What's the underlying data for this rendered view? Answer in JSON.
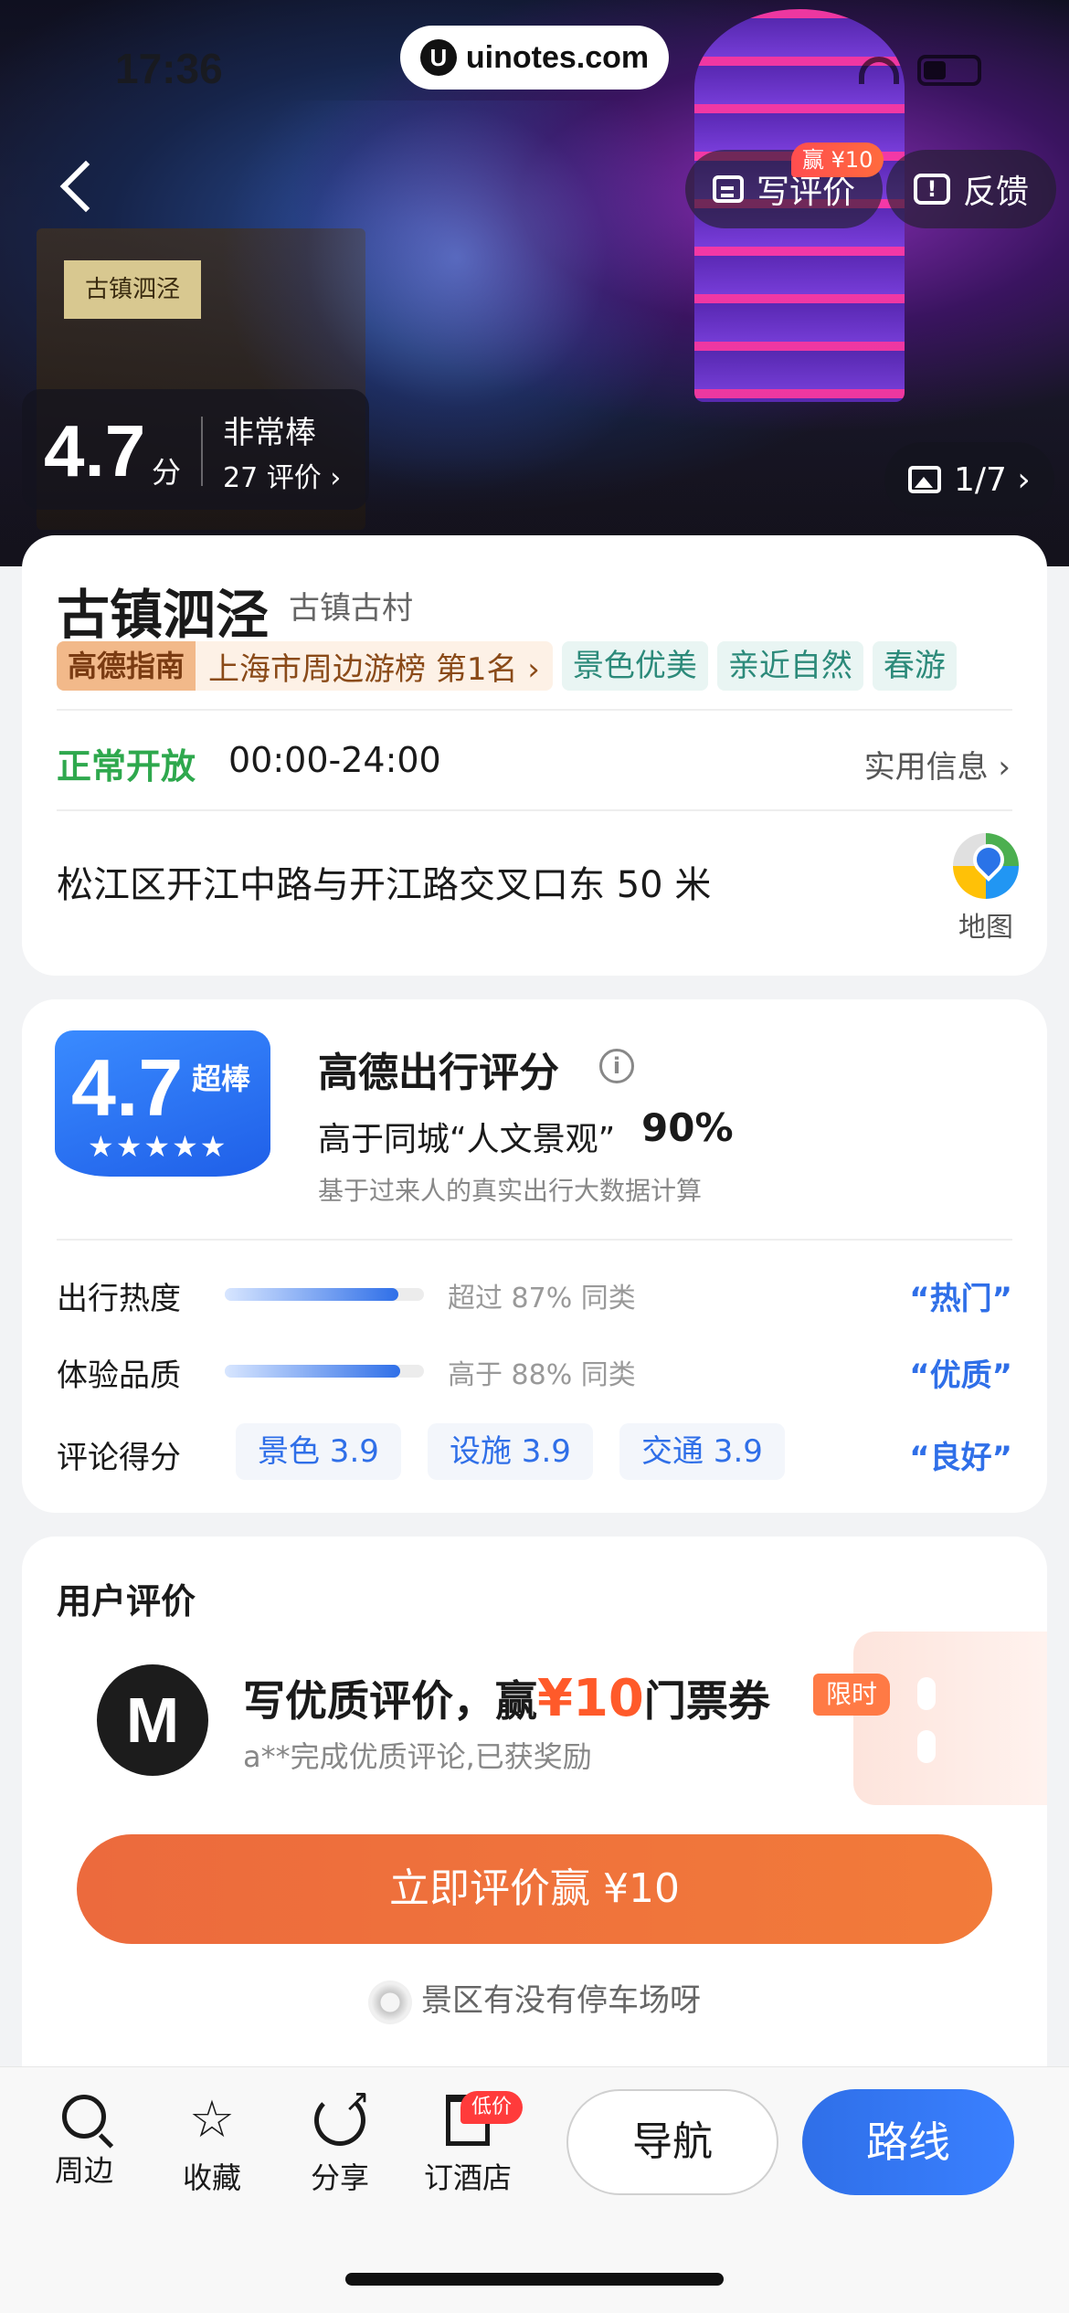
{
  "status_bar": {
    "time": "17:36",
    "watermark": "uinotes.com"
  },
  "header": {
    "write_review_label": "写评价",
    "reward_badge": "赢 ¥10",
    "feedback_label": "反馈",
    "sign_text": "古镇泗泾"
  },
  "hero": {
    "score": "4.7",
    "score_unit": "分",
    "rating_label": "非常棒",
    "review_count": "27 评价 ›",
    "photo_index": "1/7 ›"
  },
  "poi": {
    "name": "古镇泗泾",
    "type": "古镇古村",
    "rank_brand": "高德指南",
    "rank_text": "上海市周边游榜 第1名 ›",
    "tags": [
      "景色优美",
      "亲近自然",
      "春游"
    ],
    "open_status": "正常开放",
    "open_hours": "00:00-24:00",
    "useful_info": "实用信息 ›",
    "address": "松江区开江中路与开江路交叉口东 50 米",
    "map_label": "地图"
  },
  "travel_score": {
    "score": "4.7",
    "badge_label": "超棒",
    "stars": "★★★★★",
    "title": "高德出行评分",
    "info_icon": "i",
    "compare_text": "高于同城“人文景观”",
    "compare_pct": "90%",
    "basis": "基于过来人的真实出行大数据计算",
    "heat": {
      "name": "出行热度",
      "fill": 0.87,
      "desc": "超过 87% 同类",
      "verdict": "“热门”"
    },
    "quality": {
      "name": "体验品质",
      "fill": 0.88,
      "desc": "高于 88% 同类",
      "verdict": "“优质”"
    },
    "review_score": {
      "name": "评论得分",
      "chips": [
        "景色 3.9",
        "设施 3.9",
        "交通 3.9"
      ],
      "verdict": "“良好”"
    }
  },
  "reviews": {
    "title": "用户评价",
    "avatar_letter": "M",
    "promo_prefix": "写优质评价，赢",
    "promo_amount": "¥10",
    "promo_suffix": "门票券",
    "limit_badge": "限时",
    "promo_sub": "a**完成优质评论,已获奖励",
    "cta": "立即评价赢 ¥10",
    "question": "景区有没有停车场呀"
  },
  "bottom_nav": {
    "nearby": "周边",
    "favorite": "收藏",
    "share": "分享",
    "hotel": "订酒店",
    "low_price_badge": "低价",
    "navigate": "导航",
    "route": "路线"
  },
  "colors": {
    "primary_blue": "#2f6fe8",
    "cta_orange": "#ec6a3d",
    "open_green": "#2ea84d",
    "promo_red": "#ff5a2a"
  }
}
